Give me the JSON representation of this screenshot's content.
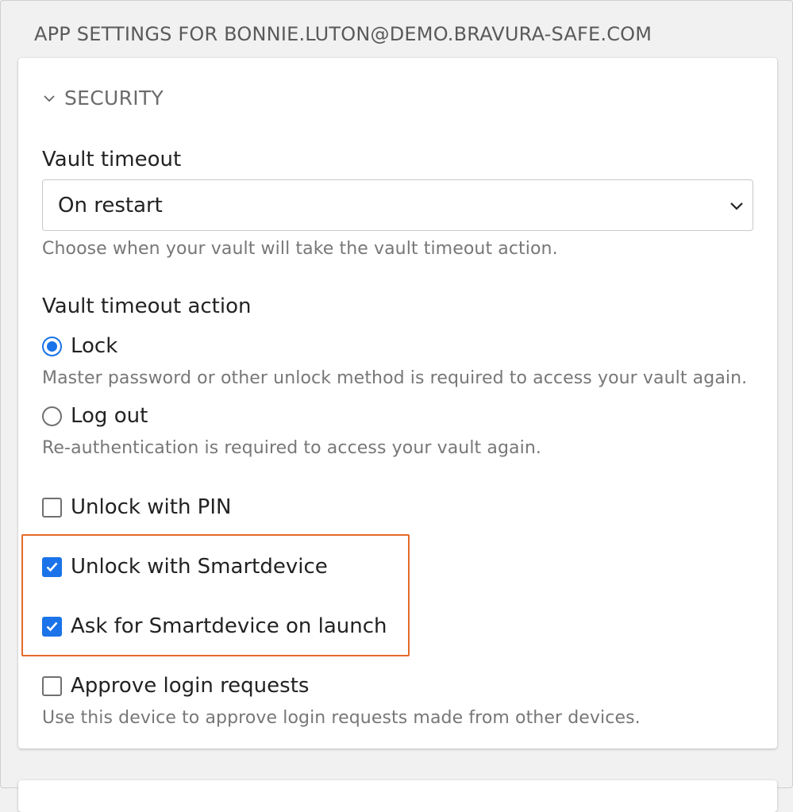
{
  "header": {
    "title": "APP SETTINGS FOR BONNIE.LUTON@DEMO.BRAVURA-SAFE.COM"
  },
  "security": {
    "section_label": "SECURITY",
    "vault_timeout": {
      "label": "Vault timeout",
      "selected": "On restart",
      "help": "Choose when your vault will take the vault timeout action."
    },
    "timeout_action": {
      "label": "Vault timeout action",
      "options": [
        {
          "label": "Lock",
          "checked": true,
          "help": "Master password or other unlock method is required to access your vault again."
        },
        {
          "label": "Log out",
          "checked": false,
          "help": "Re-authentication is required to access your vault again."
        }
      ]
    },
    "checkboxes": [
      {
        "label": "Unlock with PIN",
        "checked": false
      },
      {
        "label": "Unlock with Smartdevice",
        "checked": true
      },
      {
        "label": "Ask for Smartdevice on launch",
        "checked": true
      },
      {
        "label": "Approve login requests",
        "checked": false,
        "help": "Use this device to approve login requests made from other devices."
      }
    ]
  },
  "colors": {
    "accent": "#1a73e8",
    "highlight": "#e46a2a"
  }
}
